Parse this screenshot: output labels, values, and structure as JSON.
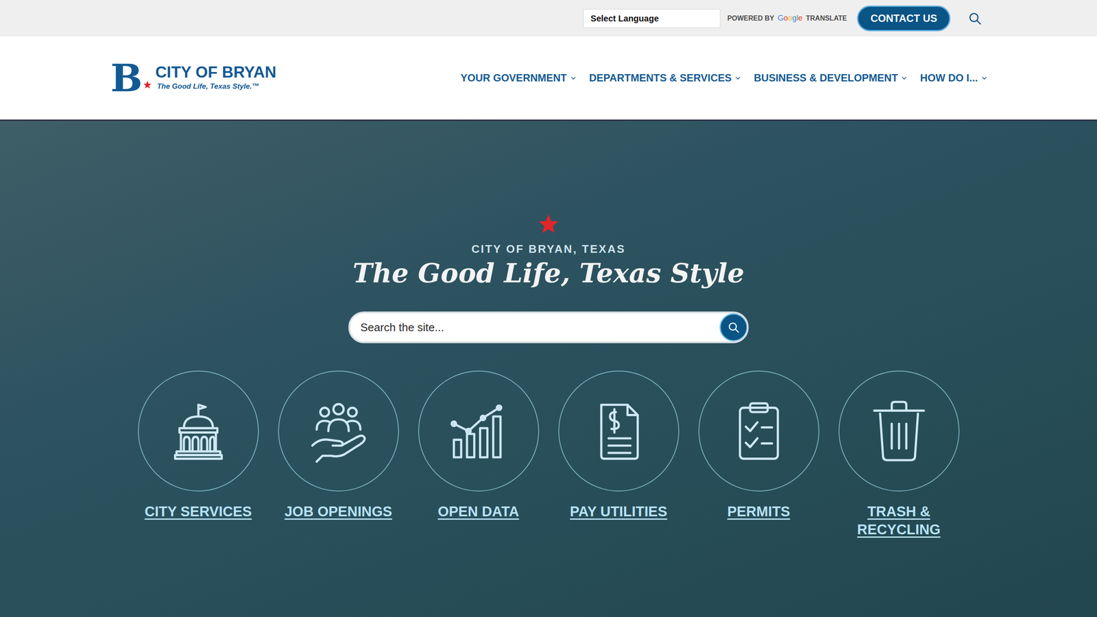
{
  "utility_bar": {
    "language_select": "Select Language",
    "powered_by": "POWERED BY",
    "google": "Google",
    "translate": "TRANSLATE",
    "contact_button": "CONTACT US"
  },
  "logo": {
    "letter": "B",
    "name": "CITY OF BRYAN",
    "tagline": "The Good Life, Texas Style.™"
  },
  "nav": [
    {
      "label": "YOUR GOVERNMENT"
    },
    {
      "label": "DEPARTMENTS & SERVICES"
    },
    {
      "label": "BUSINESS & DEVELOPMENT"
    },
    {
      "label": "HOW DO I..."
    }
  ],
  "hero": {
    "eyebrow": "CITY OF BRYAN, TEXAS",
    "title": "The Good Life, Texas Style",
    "search": {
      "placeholder": "Search the site..."
    }
  },
  "quick_links": [
    {
      "label": "CITY SERVICES"
    },
    {
      "label": "JOB OPENINGS"
    },
    {
      "label": "OPEN DATA"
    },
    {
      "label": "PAY UTILITIES"
    },
    {
      "label": "PERMITS"
    },
    {
      "label": "TRASH & RECYCLING"
    }
  ]
}
